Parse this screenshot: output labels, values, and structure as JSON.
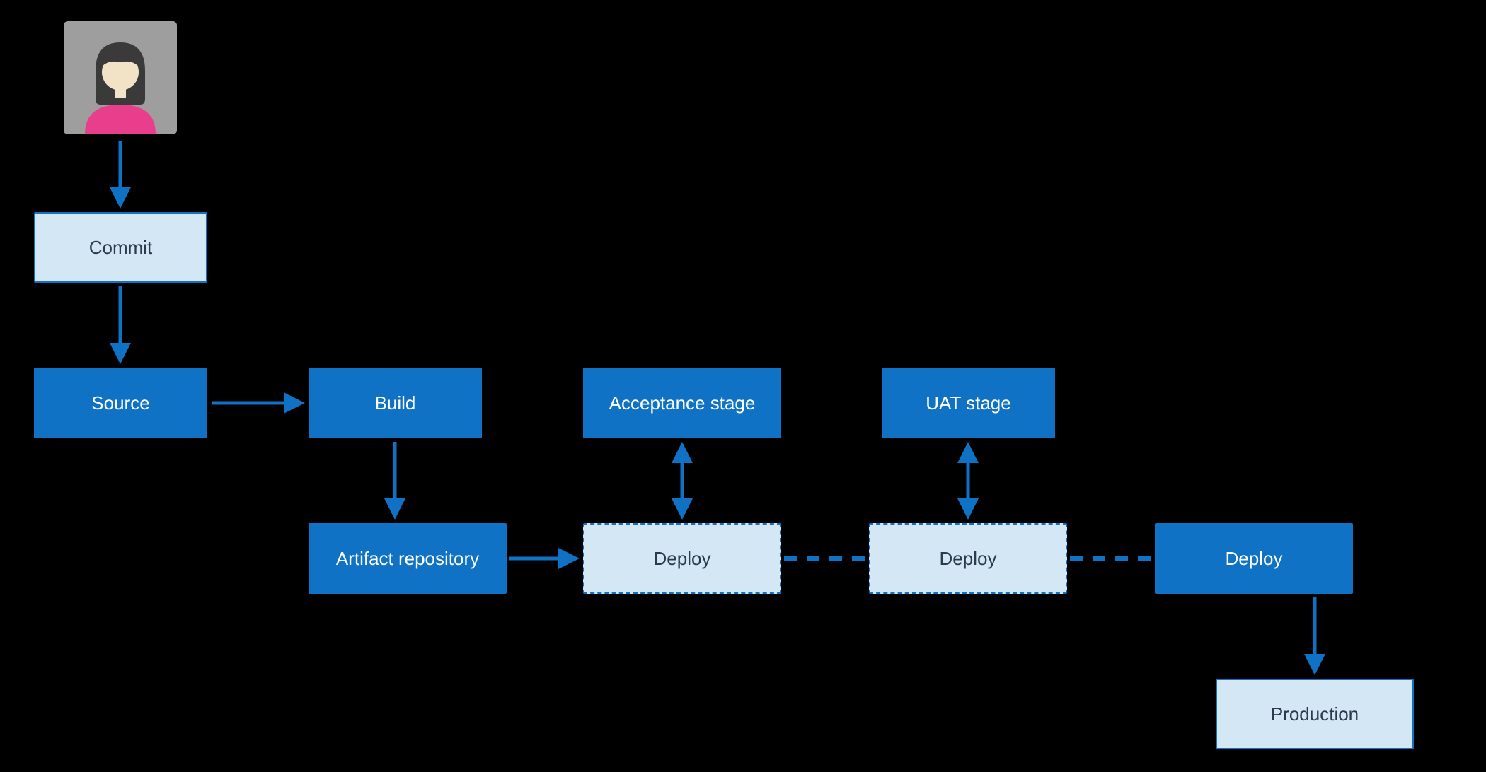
{
  "nodes": {
    "commit": {
      "label": "Commit"
    },
    "source": {
      "label": "Source"
    },
    "build": {
      "label": "Build"
    },
    "artifact": {
      "label": "Artifact repository"
    },
    "acceptance": {
      "label": "Acceptance stage"
    },
    "uat": {
      "label": "UAT stage"
    },
    "deploy1": {
      "label": "Deploy"
    },
    "deploy2": {
      "label": "Deploy"
    },
    "deploy3": {
      "label": "Deploy"
    },
    "production": {
      "label": "Production"
    }
  },
  "colors": {
    "solid_bg": "#0f72c4",
    "light_bg": "#d3e7f5",
    "text_dark": "#2a3b4c",
    "arrow": "#0f72c4"
  }
}
